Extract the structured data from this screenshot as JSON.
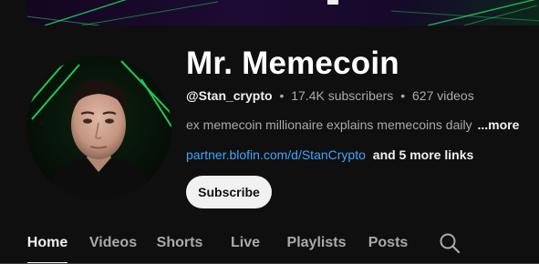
{
  "channel": {
    "name": "Mr. Memecoin",
    "handle": "@Stan_crypto",
    "subscribers": "17.4K subscribers",
    "videos": "627 videos",
    "separator": "•",
    "description": "ex memecoin millionaire explains memecoins daily",
    "description_more": "...more",
    "link": "partner.blofin.com/d/StanCrypto",
    "more_links": "and 5 more links",
    "subscribe_label": "Subscribe"
  },
  "tabs": [
    {
      "label": "Home",
      "active": true
    },
    {
      "label": "Videos",
      "active": false
    },
    {
      "label": "Shorts",
      "active": false
    },
    {
      "label": "Live",
      "active": false
    },
    {
      "label": "Playlists",
      "active": false
    },
    {
      "label": "Posts",
      "active": false
    }
  ],
  "icons": {
    "search": "search-icon"
  },
  "colors": {
    "background": "#0f0f0f",
    "link": "#3ea6ff",
    "subscribe_bg": "#f1f1f1",
    "muted_text": "#aaaaaa"
  }
}
